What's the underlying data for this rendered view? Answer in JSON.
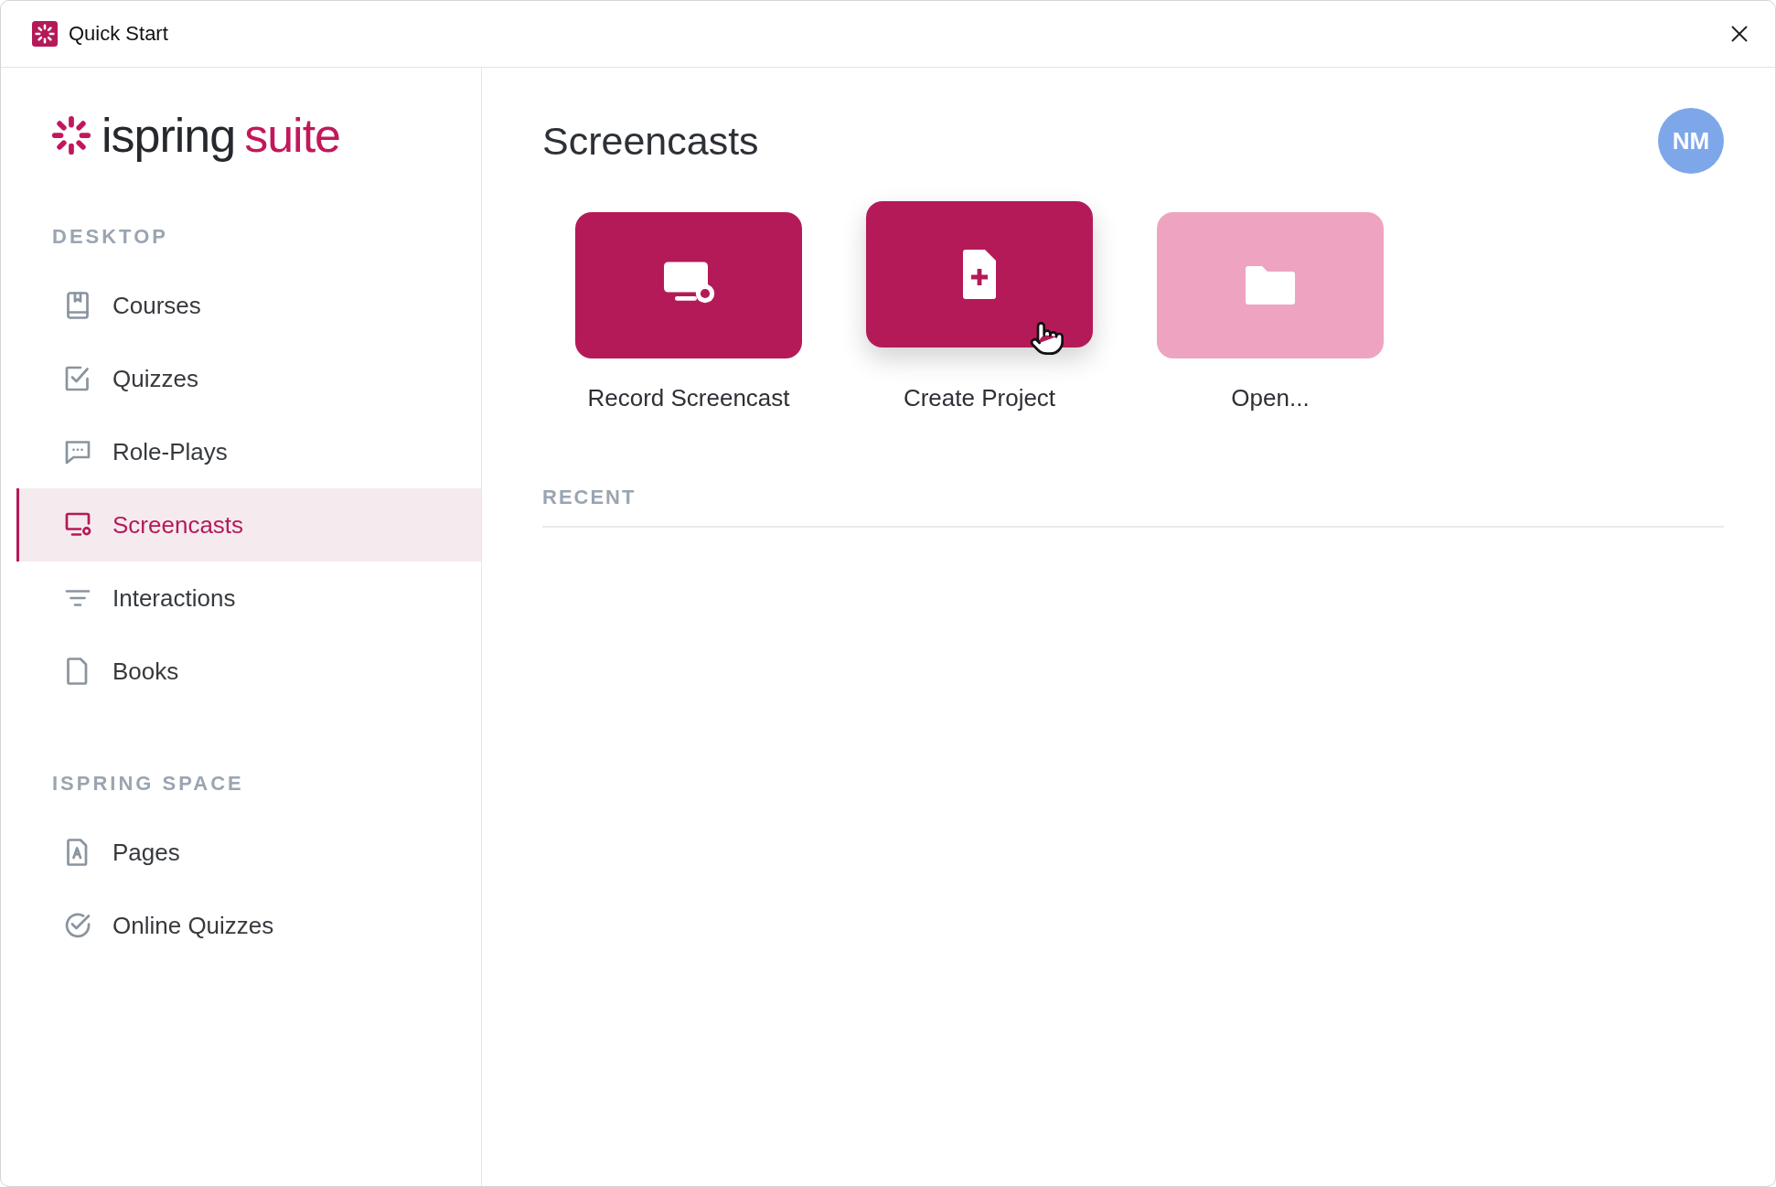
{
  "window": {
    "title": "Quick Start"
  },
  "sidebar": {
    "logo": {
      "word1": "ispring",
      "word2": "suite"
    },
    "sections": [
      {
        "heading": "DESKTOP",
        "items": [
          {
            "label": "Courses",
            "kind": "book",
            "selected": false
          },
          {
            "label": "Quizzes",
            "kind": "check-square",
            "selected": false
          },
          {
            "label": "Role-Plays",
            "kind": "chat",
            "selected": false
          },
          {
            "label": "Screencasts",
            "kind": "screen",
            "selected": true
          },
          {
            "label": "Interactions",
            "kind": "lines",
            "selected": false
          },
          {
            "label": "Books",
            "kind": "file",
            "selected": false
          }
        ]
      },
      {
        "heading": "ISPRING SPACE",
        "items": [
          {
            "label": "Pages",
            "kind": "page",
            "selected": false
          },
          {
            "label": "Online Quizzes",
            "kind": "check-circle",
            "selected": false
          }
        ]
      }
    ]
  },
  "main": {
    "title": "Screencasts",
    "avatar": "NM",
    "actions": [
      {
        "label": "Record Screencast",
        "kind": "record",
        "hovered": false
      },
      {
        "label": "Create Project",
        "kind": "create",
        "hovered": true
      },
      {
        "label": "Open...",
        "kind": "open",
        "hovered": false
      }
    ],
    "recent": {
      "heading": "RECENT"
    }
  }
}
